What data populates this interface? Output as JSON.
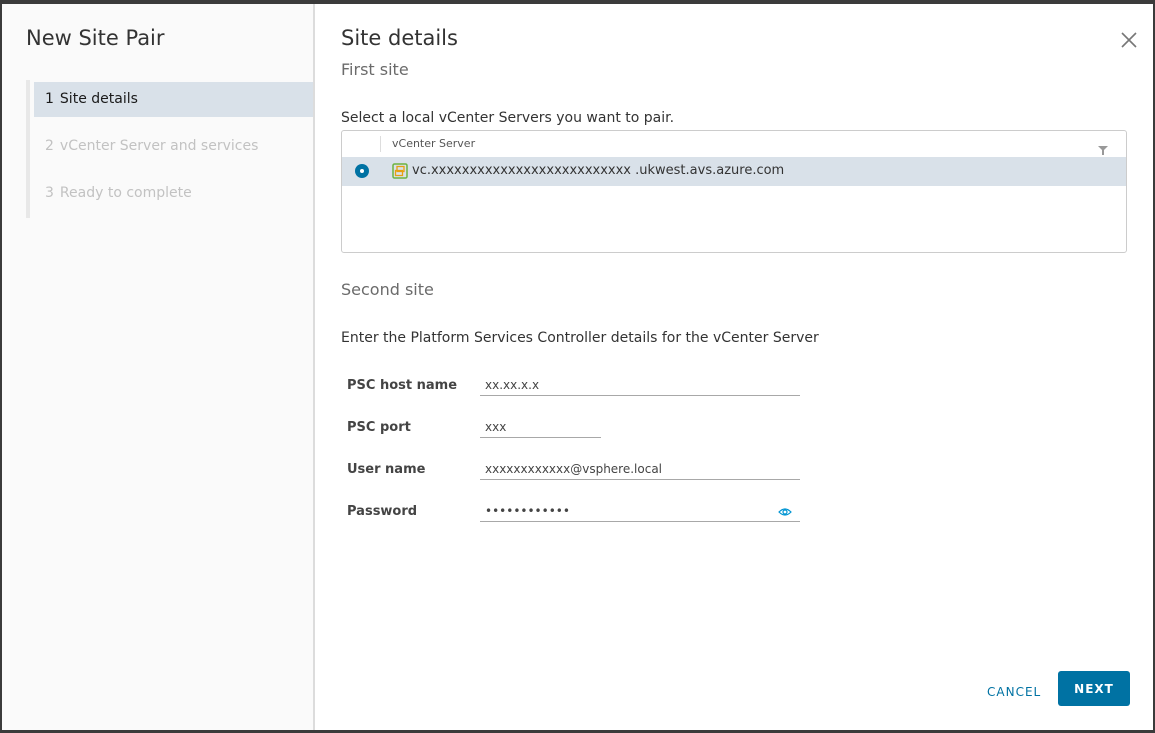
{
  "wizard": {
    "title": "New Site Pair",
    "steps": [
      {
        "number": "1",
        "label": "Site details",
        "state": "active"
      },
      {
        "number": "2",
        "label": "vCenter Server and services",
        "state": "disabled"
      },
      {
        "number": "3",
        "label": "Ready to complete",
        "state": "disabled"
      }
    ]
  },
  "page": {
    "title": "Site details",
    "close_icon": "close-icon"
  },
  "first_site": {
    "heading": "First site",
    "instruction": "Select a local vCenter Servers you want to pair.",
    "grid": {
      "column_header": "vCenter Server",
      "filter_icon": "filter-icon",
      "rows": [
        {
          "selected": true,
          "icon": "vcenter-icon",
          "name": "vc.xxxxxxxxxxxxxxxxxxxxxxxxxx .ukwest.avs.azure.com"
        }
      ]
    }
  },
  "second_site": {
    "heading": "Second site",
    "instruction": "Enter the Platform Services Controller details for the vCenter Server",
    "fields": {
      "psc_host": {
        "label": "PSC host name",
        "value": "xx.xx.x.x"
      },
      "psc_port": {
        "label": "PSC port",
        "value": "xxx"
      },
      "user_name": {
        "label": "User name",
        "value": "xxxxxxxxxxxx@vsphere.local"
      },
      "password": {
        "label": "Password",
        "value": "••••••••••••",
        "reveal_icon": "eye-icon"
      }
    }
  },
  "footer": {
    "cancel_label": "CANCEL",
    "next_label": "NEXT"
  },
  "colors": {
    "accent": "#0072a3",
    "selected_row": "#d9e1e9",
    "vcenter_icon_green": "#6db33f",
    "vcenter_icon_orange": "#e6a010"
  }
}
